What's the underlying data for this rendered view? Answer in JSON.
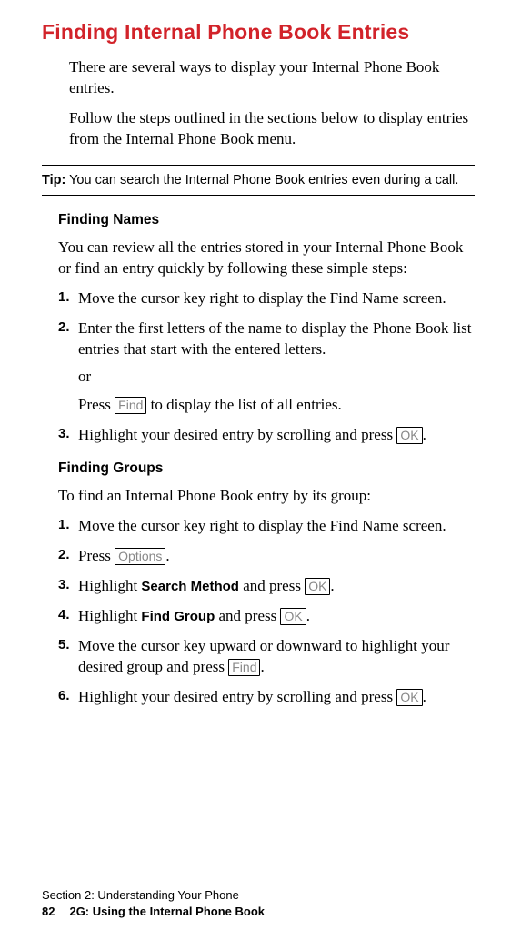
{
  "title": "Finding Internal Phone Book Entries",
  "intro": {
    "p1": "There are several ways to display your Internal Phone Book entries.",
    "p2": "Follow the steps outlined in the sections below to display entries from the Internal Phone Book menu."
  },
  "tip": {
    "label": "Tip:",
    "text": " You can search the Internal Phone Book entries even during a call."
  },
  "section1": {
    "heading": "Finding Names",
    "intro": "You can review all the entries stored in your Internal Phone Book or find an entry quickly by following these simple steps:",
    "steps": {
      "s1": "Move the cursor key right to display the Find Name screen.",
      "s2": "Enter the first letters of the name to display the Phone Book list entries that start with the entered letters.",
      "s2or": "or",
      "s2b_pre": "Press ",
      "s2b_key": "Find",
      "s2b_post": " to display the list of all entries.",
      "s3_pre": "Highlight your desired entry by scrolling and press ",
      "s3_key": "OK",
      "s3_post": "."
    }
  },
  "section2": {
    "heading": "Finding Groups",
    "intro": "To find an Internal Phone Book entry by its group:",
    "steps": {
      "s1": "Move the cursor key right to display the Find Name screen.",
      "s2_pre": "Press ",
      "s2_key": "Options",
      "s2_post": ".",
      "s3_pre": "Highlight ",
      "s3_bold": "Search Method",
      "s3_mid": " and press ",
      "s3_key": "OK",
      "s3_post": ".",
      "s4_pre": "Highlight ",
      "s4_bold": "Find Group",
      "s4_mid": " and press ",
      "s4_key": "OK",
      "s4_post": ".",
      "s5_pre": "Move the cursor key upward or downward to highlight your desired group and press ",
      "s5_key": "Find",
      "s5_post": ".",
      "s6_pre": "Highlight your desired entry by scrolling and press ",
      "s6_key": "OK",
      "s6_post": "."
    }
  },
  "footer": {
    "line1": "Section 2: Understanding Your Phone",
    "pagenum": "82",
    "line2": "2G: Using the Internal Phone Book"
  }
}
